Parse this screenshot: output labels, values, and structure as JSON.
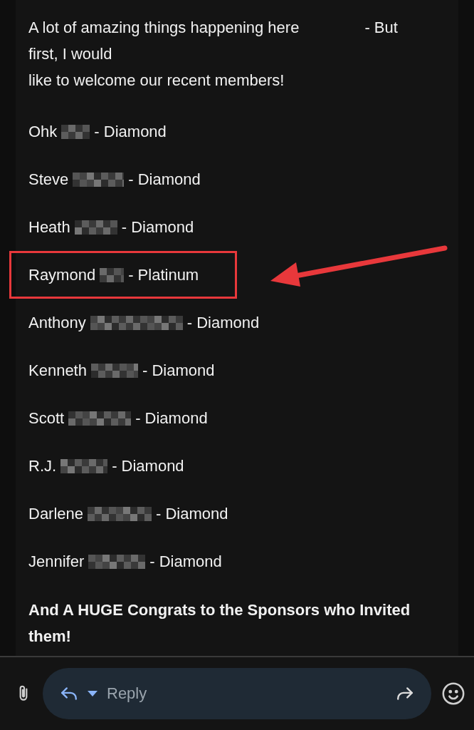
{
  "message": {
    "intro": {
      "lines": [
        [
          "A lot of amazing things happening here",
          "- But"
        ],
        [
          "first, I would"
        ],
        [
          "like to welcome our recent members!"
        ]
      ]
    },
    "members": [
      {
        "name": "Ohk",
        "tier": "- Diamond",
        "highlighted": false
      },
      {
        "name": "Steve",
        "tier": "- Diamond",
        "highlighted": false
      },
      {
        "name": "Heath",
        "tier": "- Diamond",
        "highlighted": false
      },
      {
        "name": "Raymond",
        "tier": "- Platinum",
        "highlighted": true
      },
      {
        "name": "Anthony",
        "tier": "- Diamond",
        "highlighted": false
      },
      {
        "name": "Kenneth",
        "tier": "- Diamond",
        "highlighted": false
      },
      {
        "name": "Scott",
        "tier": "- Diamond",
        "highlighted": false
      },
      {
        "name": "R.J.",
        "tier": "- Diamond",
        "highlighted": false
      },
      {
        "name": "Darlene",
        "tier": "- Diamond",
        "highlighted": false
      },
      {
        "name": "Jennifer",
        "tier": "- Diamond",
        "highlighted": false
      }
    ],
    "closing": "And A HUGE Congrats to the Sponsors who Invited them!"
  },
  "reply_bar": {
    "placeholder": "Reply"
  }
}
